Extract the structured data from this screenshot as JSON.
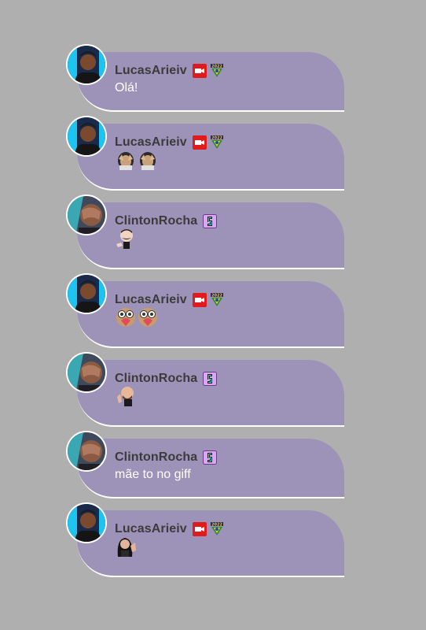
{
  "messages": [
    {
      "user": "LucasArieiv",
      "badges": [
        "camera-badge-icon",
        "soccer-2022-badge-icon"
      ],
      "text": "Olá!",
      "emotes": []
    },
    {
      "user": "LucasArieiv",
      "badges": [
        "camera-badge-icon",
        "soccer-2022-badge-icon"
      ],
      "text": "",
      "emotes": [
        "face-palm-emote",
        "face-palm-emote"
      ]
    },
    {
      "user": "ClintonRocha",
      "badges": [
        "subscriber-badge-icon"
      ],
      "text": "",
      "emotes": [
        "mustache-man-emote"
      ]
    },
    {
      "user": "LucasArieiv",
      "badges": [
        "camera-badge-icon",
        "soccer-2022-badge-icon"
      ],
      "text": "",
      "emotes": [
        "owl-heart-emote",
        "owl-heart-emote"
      ]
    },
    {
      "user": "ClintonRocha",
      "badges": [
        "subscriber-badge-icon"
      ],
      "text": "",
      "emotes": [
        "bald-man-wave-emote"
      ]
    },
    {
      "user": "ClintonRocha",
      "badges": [
        "subscriber-badge-icon"
      ],
      "text": "mãe to no giff",
      "emotes": []
    },
    {
      "user": "LucasArieiv",
      "badges": [
        "camera-badge-icon",
        "soccer-2022-badge-icon"
      ],
      "text": "",
      "emotes": [
        "woman-wave-emote"
      ]
    }
  ],
  "colors": {
    "background": "#afafaf",
    "bubble": "#9d92b7",
    "username": "#3b3b3b",
    "text": "#ffffff",
    "camera_badge": "#e01b1b"
  }
}
